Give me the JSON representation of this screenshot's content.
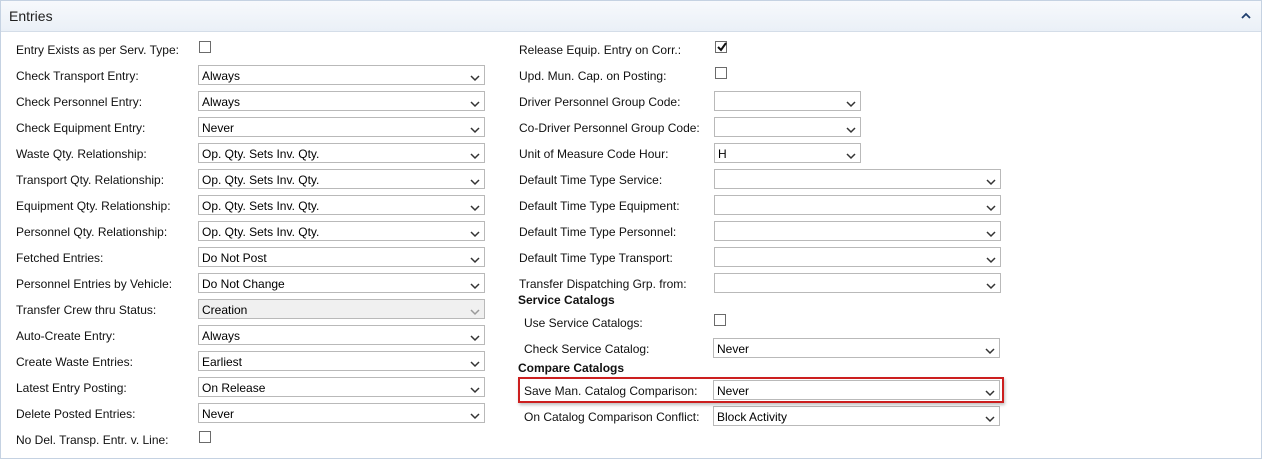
{
  "header": {
    "title": "Entries"
  },
  "left": [
    {
      "label": "Entry Exists as per Serv. Type:",
      "type": "checkbox",
      "checked": false
    },
    {
      "label": "Check Transport Entry:",
      "type": "select",
      "value": "Always"
    },
    {
      "label": "Check Personnel Entry:",
      "type": "select",
      "value": "Always"
    },
    {
      "label": "Check Equipment Entry:",
      "type": "select",
      "value": "Never"
    },
    {
      "label": "Waste Qty. Relationship:",
      "type": "select",
      "value": "Op. Qty. Sets Inv. Qty."
    },
    {
      "label": "Transport Qty. Relationship:",
      "type": "select",
      "value": "Op. Qty. Sets Inv. Qty."
    },
    {
      "label": "Equipment Qty. Relationship:",
      "type": "select",
      "value": "Op. Qty. Sets Inv. Qty."
    },
    {
      "label": "Personnel Qty. Relationship:",
      "type": "select",
      "value": "Op. Qty. Sets Inv. Qty."
    },
    {
      "label": "Fetched Entries:",
      "type": "select",
      "value": "Do Not Post"
    },
    {
      "label": "Personnel Entries by Vehicle:",
      "type": "select",
      "value": "Do Not Change"
    },
    {
      "label": "Transfer Crew thru Status:",
      "type": "select",
      "value": "Creation",
      "disabled": true
    },
    {
      "label": "Auto-Create Entry:",
      "type": "select",
      "value": "Always"
    },
    {
      "label": "Create Waste Entries:",
      "type": "select",
      "value": "Earliest"
    },
    {
      "label": "Latest Entry Posting:",
      "type": "select",
      "value": "On Release"
    },
    {
      "label": "Delete Posted Entries:",
      "type": "select",
      "value": "Never"
    },
    {
      "label": "No Del. Transp. Entr. v. Line:",
      "type": "checkbox",
      "checked": false
    }
  ],
  "right": [
    {
      "label": "Release Equip. Entry on Corr.:",
      "type": "checkbox",
      "checked": true
    },
    {
      "label": "Upd. Mun. Cap. on Posting:",
      "type": "checkbox",
      "checked": false
    },
    {
      "label": "Driver Personnel Group Code:",
      "type": "select",
      "value": "",
      "size": "short"
    },
    {
      "label": "Co-Driver Personnel Group Code:",
      "type": "select",
      "value": "",
      "size": "short"
    },
    {
      "label": "Unit of Measure Code Hour:",
      "type": "select",
      "value": "H",
      "size": "short"
    },
    {
      "label": "Default Time Type Service:",
      "type": "select",
      "value": ""
    },
    {
      "label": "Default Time Type Equipment:",
      "type": "select",
      "value": ""
    },
    {
      "label": "Default Time Type Personnel:",
      "type": "select",
      "value": ""
    },
    {
      "label": "Default Time Type Transport:",
      "type": "select",
      "value": ""
    },
    {
      "label": "Transfer Dispatching Grp. from:",
      "type": "select",
      "value": ""
    }
  ],
  "service_catalogs": {
    "title": "Service Catalogs",
    "items": [
      {
        "label": "Use Service Catalogs:",
        "type": "checkbox",
        "checked": false
      },
      {
        "label": "Check Service Catalog:",
        "type": "select",
        "value": "Never"
      }
    ]
  },
  "compare_catalogs": {
    "title": "Compare Catalogs",
    "items": [
      {
        "label": "Save Man. Catalog Comparison:",
        "type": "select",
        "value": "Never",
        "highlighted": true
      },
      {
        "label": "On Catalog Comparison Conflict:",
        "type": "select",
        "value": "Block Activity"
      }
    ]
  },
  "colors": {
    "highlight": "#cc1f1f",
    "border": "#b9b9b9",
    "header_bg": "#eaf0f7"
  }
}
